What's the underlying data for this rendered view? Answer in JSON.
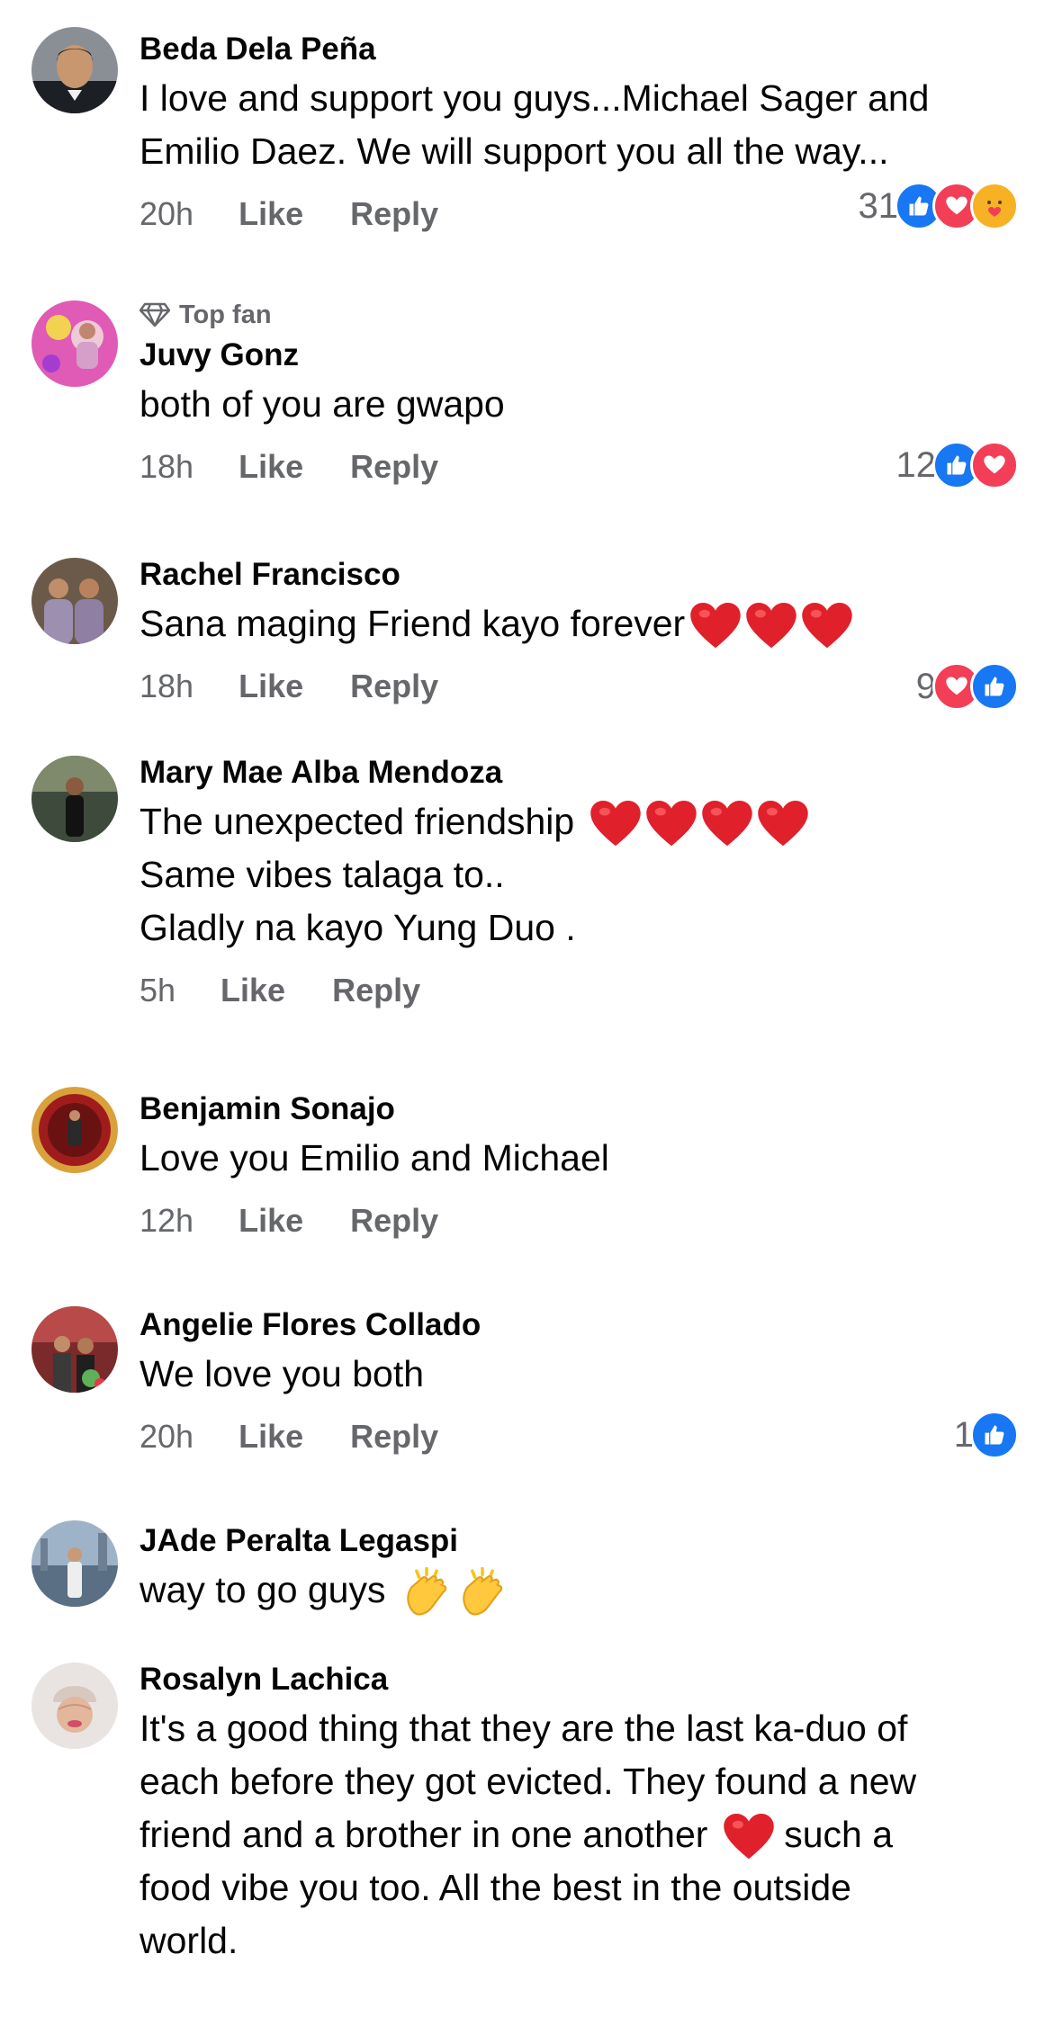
{
  "comments": [
    {
      "name": "Beda Dela Peña",
      "lines": [
        "I love and support you guys...Michael Sager and",
        "Emilio Daez. We will support you all the way..."
      ],
      "time": "20h",
      "like": "Like",
      "reply": "Reply",
      "reaction_count": "31",
      "reactions": [
        "like-icon",
        "love-icon",
        "care-icon"
      ]
    },
    {
      "badge": "Top fan",
      "name": "Juvy Gonz",
      "lines": [
        "both of you are gwapo"
      ],
      "time": "18h",
      "like": "Like",
      "reply": "Reply",
      "reaction_count": "12",
      "reactions": [
        "like-icon",
        "love-icon"
      ]
    },
    {
      "name": "Rachel Francisco",
      "lines": [
        "Sana maging Friend kayo forever"
      ],
      "time": "18h",
      "like": "Like",
      "reply": "Reply",
      "reaction_count": "9",
      "reactions": [
        "love-icon",
        "like-icon"
      ]
    },
    {
      "name": "Mary Mae Alba Mendoza",
      "lines": [
        "The unexpected friendship",
        "Same vibes talaga to..",
        "Gladly na kayo Yung Duo ."
      ],
      "time": "5h",
      "like": "Like",
      "reply": "Reply"
    },
    {
      "name": "Benjamin Sonajo",
      "lines": [
        "Love you Emilio and Michael"
      ],
      "time": "12h",
      "like": "Like",
      "reply": "Reply"
    },
    {
      "name": "Angelie Flores Collado",
      "lines": [
        "We love you both"
      ],
      "time": "20h",
      "like": "Like",
      "reply": "Reply",
      "reaction_count": "1",
      "reactions": [
        "like-icon"
      ]
    },
    {
      "name": "JAde Peralta Legaspi",
      "lines": [
        "way to go guys"
      ]
    },
    {
      "name": "Rosalyn Lachica",
      "lines": [
        "It's a good thing that they are the last ka-duo of",
        "each before they got evicted. They found a new",
        "friend and a brother in one another",
        "such a",
        "food vibe you too. All the best in the outside",
        "world."
      ]
    }
  ],
  "colors": {
    "like": "#1877f2",
    "love": "#f33e58",
    "care": "#f7b125",
    "meta": "#65676b",
    "heart_emoji": "#e0202b",
    "clap_emoji": "#f5c518"
  }
}
